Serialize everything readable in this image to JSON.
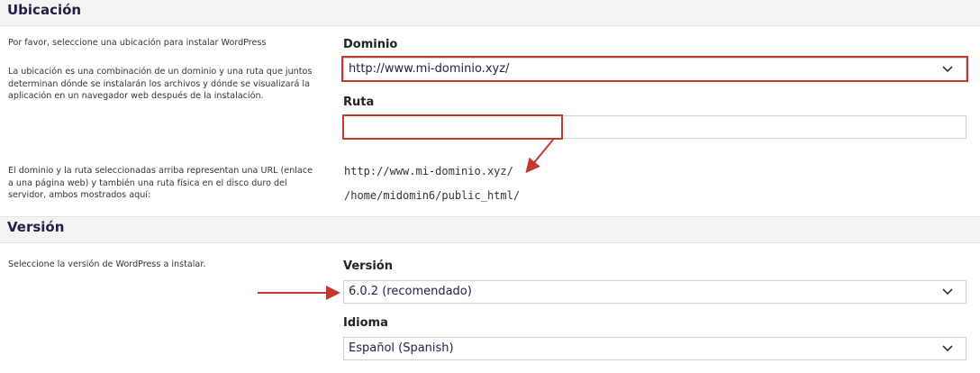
{
  "ubicacion": {
    "title": "Ubicación",
    "intro": "Por favor, seleccione una ubicación para instalar WordPress",
    "explanation": "La ubicación es una combinación de un dominio y una ruta que juntos determinan dónde se instalarán los archivos y dónde se visualizará la aplicación en un navegador web después de la instalación.",
    "result_note": "El dominio y la ruta seleccionadas arriba representan una URL (enlace a una página web) y también una ruta física en el disco duro del servidor, ambos mostrados aquí:",
    "domain_label": "Dominio",
    "domain_value": "http://www.mi-dominio.xyz/",
    "path_label": "Ruta",
    "path_value": "",
    "url_preview": "http://www.mi-dominio.xyz/",
    "disk_path": "/home/midomin6/public_html/"
  },
  "version": {
    "title": "Versión",
    "intro": "Seleccione la versión de WordPress a instalar.",
    "version_label": "Versión",
    "version_value": "6.0.2 (recomendado)",
    "language_label": "Idioma",
    "language_value": "Español (Spanish)"
  },
  "icons": {
    "dropdown": "chevron-down-icon"
  },
  "colors": {
    "highlight": "#c4392f",
    "heading": "#1c2145"
  }
}
